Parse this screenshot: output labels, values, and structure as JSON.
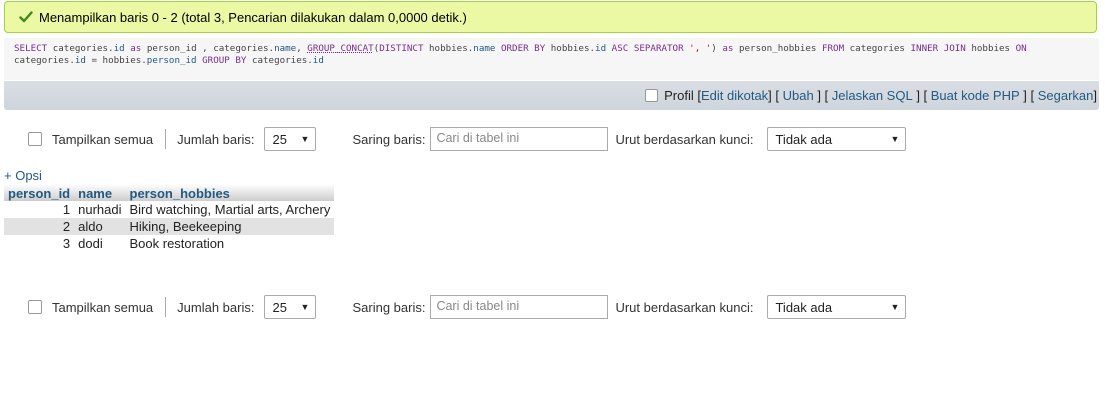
{
  "message": {
    "icon": "check-icon",
    "text": "Menampilkan baris 0 - 2 (total 3, Pencarian dilakukan dalam 0,0000 detik.)"
  },
  "sql": {
    "line1_tokens": [
      {
        "t": "SELECT",
        "c": "kw"
      },
      {
        "t": " categories.",
        "c": ""
      },
      {
        "t": "id",
        "c": "col"
      },
      {
        "t": " ",
        "c": ""
      },
      {
        "t": "as",
        "c": "kw"
      },
      {
        "t": " person_id , categories.",
        "c": ""
      },
      {
        "t": "name",
        "c": "col"
      },
      {
        "t": ", ",
        "c": ""
      },
      {
        "t": "GROUP_CONCAT",
        "c": "fn"
      },
      {
        "t": "(",
        "c": ""
      },
      {
        "t": "DISTINCT",
        "c": "kw"
      },
      {
        "t": " hobbies.",
        "c": ""
      },
      {
        "t": "name",
        "c": "col"
      },
      {
        "t": " ",
        "c": ""
      },
      {
        "t": "ORDER BY",
        "c": "kw"
      },
      {
        "t": " hobbies.",
        "c": ""
      },
      {
        "t": "id",
        "c": "col"
      },
      {
        "t": " ",
        "c": ""
      },
      {
        "t": "ASC",
        "c": "kw"
      },
      {
        "t": " ",
        "c": ""
      },
      {
        "t": "SEPARATOR",
        "c": "kw"
      },
      {
        "t": " ",
        "c": ""
      },
      {
        "t": "', '",
        "c": "str"
      },
      {
        "t": ") ",
        "c": ""
      },
      {
        "t": "as",
        "c": "kw"
      },
      {
        "t": " person_hobbies ",
        "c": ""
      },
      {
        "t": "FROM",
        "c": "kw"
      },
      {
        "t": " categories ",
        "c": ""
      },
      {
        "t": "INNER JOIN",
        "c": "kw"
      },
      {
        "t": " hobbies ",
        "c": ""
      },
      {
        "t": "ON",
        "c": "kw"
      }
    ],
    "line2_tokens": [
      {
        "t": "categories.",
        "c": ""
      },
      {
        "t": "id",
        "c": "col"
      },
      {
        "t": " = hobbies.",
        "c": ""
      },
      {
        "t": "person_id",
        "c": "col"
      },
      {
        "t": " ",
        "c": ""
      },
      {
        "t": "GROUP BY",
        "c": "kw"
      },
      {
        "t": " categories.",
        "c": ""
      },
      {
        "t": "id",
        "c": "col"
      }
    ]
  },
  "query_tools": {
    "profil_label": "Profil",
    "links": [
      "Edit dikotak",
      "Ubah",
      "Jelaskan SQL",
      "Buat kode PHP",
      "Segarkan"
    ]
  },
  "navigation": {
    "show_all_label": "Tampilkan semua",
    "rows_label": "Jumlah baris:",
    "rows_value": "25",
    "filter_label": "Saring baris:",
    "filter_placeholder": "Cari di tabel ini",
    "sort_label": "Urut berdasarkan kunci:",
    "sort_value": "Tidak ada"
  },
  "options_link": "+ Opsi",
  "table": {
    "columns": [
      "person_id",
      "name",
      "person_hobbies"
    ],
    "rows": [
      [
        "1",
        "nurhadi",
        "Bird watching, Martial arts, Archery"
      ],
      [
        "2",
        "aldo",
        "Hiking, Beekeeping"
      ],
      [
        "3",
        "dodi",
        "Book restoration"
      ]
    ]
  }
}
